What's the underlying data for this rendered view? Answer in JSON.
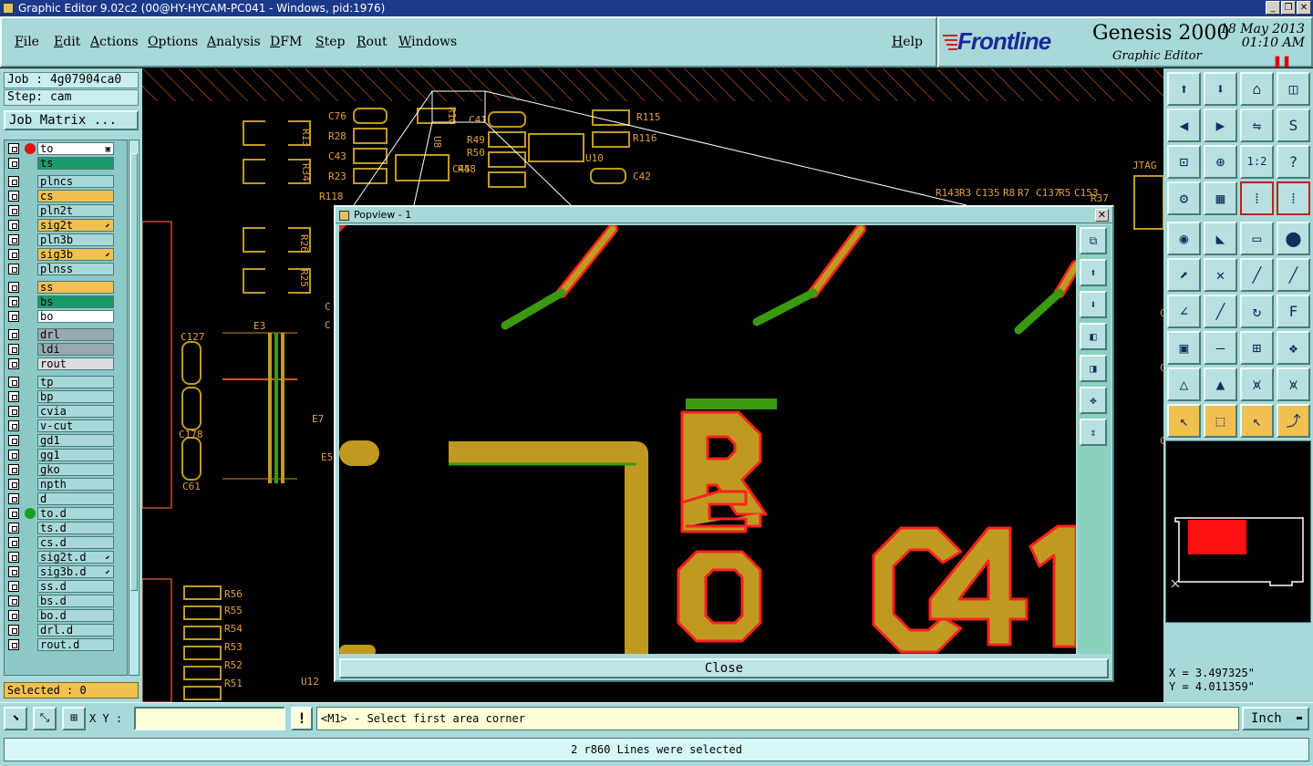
{
  "window": {
    "title": "Graphic Editor 9.02c2 (00@HY-HYCAM-PC041 - Windows, pid:1976)",
    "controls": [
      "_",
      "❐",
      "✕"
    ]
  },
  "menu": {
    "items": [
      "File",
      "Edit",
      "Actions",
      "Options",
      "Analysis",
      "DFM",
      "Step",
      "Rout",
      "Windows"
    ],
    "help": "Help"
  },
  "brand": {
    "logo": "Frontline",
    "product": "Genesis 2000",
    "subtitle": "Graphic Editor",
    "date": "18 May 2013",
    "time": "01:10 AM",
    "pause_glyph": "❚❚"
  },
  "left": {
    "job": "Job : 4g07904ca0",
    "step": "Step: cam",
    "job_matrix": "Job Matrix ...",
    "selected": "Selected : 0",
    "layers": [
      {
        "name": "to",
        "bg": "#ffffff",
        "dot": "#e01010",
        "mark": "▣",
        "active": true
      },
      {
        "name": "ts",
        "bg": "#1a9a6a",
        "dot": "",
        "mark": ""
      },
      {
        "name": "plncs",
        "bg": "#a8d8d8",
        "dot": "",
        "mark": ""
      },
      {
        "name": "cs",
        "bg": "#f0c050",
        "dot": "",
        "mark": ""
      },
      {
        "name": "pln2t",
        "bg": "#a8d8d8",
        "dot": "",
        "mark": ""
      },
      {
        "name": "sig2t",
        "bg": "#f0c050",
        "dot": "",
        "mark": "⬋"
      },
      {
        "name": "pln3b",
        "bg": "#a8d8d8",
        "dot": "",
        "mark": ""
      },
      {
        "name": "sig3b",
        "bg": "#f0c050",
        "dot": "",
        "mark": "⬋"
      },
      {
        "name": "plnss",
        "bg": "#a8d8d8",
        "dot": "",
        "mark": ""
      },
      {
        "name": "ss",
        "bg": "#f0c050",
        "dot": "",
        "mark": ""
      },
      {
        "name": "bs",
        "bg": "#1a9a6a",
        "dot": "",
        "mark": ""
      },
      {
        "name": "bo",
        "bg": "#ffffff",
        "dot": "",
        "mark": ""
      },
      {
        "name": "drl",
        "bg": "#9aa8b0",
        "dot": "",
        "mark": ""
      },
      {
        "name": "ldi",
        "bg": "#9aa8b0",
        "dot": "",
        "mark": ""
      },
      {
        "name": "rout",
        "bg": "#dcdcdc",
        "dot": "",
        "mark": ""
      },
      {
        "name": "tp",
        "bg": "#a8d8d8",
        "dot": "",
        "mark": ""
      },
      {
        "name": "bp",
        "bg": "#a8d8d8",
        "dot": "",
        "mark": ""
      },
      {
        "name": "cvia",
        "bg": "#a8d8d8",
        "dot": "",
        "mark": ""
      },
      {
        "name": "v-cut",
        "bg": "#a8d8d8",
        "dot": "",
        "mark": ""
      },
      {
        "name": "gd1",
        "bg": "#a8d8d8",
        "dot": "",
        "mark": ""
      },
      {
        "name": "gg1",
        "bg": "#a8d8d8",
        "dot": "",
        "mark": ""
      },
      {
        "name": "gko",
        "bg": "#a8d8d8",
        "dot": "",
        "mark": ""
      },
      {
        "name": "npth",
        "bg": "#a8d8d8",
        "dot": "",
        "mark": ""
      },
      {
        "name": "d",
        "bg": "#a8d8d8",
        "dot": "",
        "mark": ""
      },
      {
        "name": "to.d",
        "bg": "#a8d8d8",
        "dot": "#1aa020",
        "mark": ""
      },
      {
        "name": "ts.d",
        "bg": "#a8d8d8",
        "dot": "",
        "mark": ""
      },
      {
        "name": "cs.d",
        "bg": "#a8d8d8",
        "dot": "",
        "mark": ""
      },
      {
        "name": "sig2t.d",
        "bg": "#a8d8d8",
        "dot": "",
        "mark": "⬋"
      },
      {
        "name": "sig3b.d",
        "bg": "#a8d8d8",
        "dot": "",
        "mark": "⬋"
      },
      {
        "name": "ss.d",
        "bg": "#a8d8d8",
        "dot": "",
        "mark": ""
      },
      {
        "name": "bs.d",
        "bg": "#a8d8d8",
        "dot": "",
        "mark": ""
      },
      {
        "name": "bo.d",
        "bg": "#a8d8d8",
        "dot": "",
        "mark": ""
      },
      {
        "name": "drl.d",
        "bg": "#a8d8d8",
        "dot": "",
        "mark": ""
      },
      {
        "name": "rout.d",
        "bg": "#a8d8d8",
        "dot": "",
        "mark": ""
      }
    ]
  },
  "canvas": {
    "refdes": [
      "C76",
      "R28",
      "C43",
      "R23",
      "R118",
      "R13",
      "R34",
      "C41",
      "R49",
      "R50",
      "R48",
      "C45",
      "U8",
      "R10",
      "R115",
      "R116",
      "U10",
      "C42",
      "R143",
      "R3",
      "C135",
      "R8",
      "R7",
      "C137",
      "R5",
      "C153",
      "R37",
      "JTAG",
      "R26",
      "R25",
      "C127",
      "E3",
      "C178",
      "C61",
      "E7",
      "E5",
      "R56",
      "R55",
      "R54",
      "R53",
      "R52",
      "R51",
      "U12",
      "C",
      "C",
      "C",
      "C",
      "C"
    ]
  },
  "popview": {
    "title": "Popview - 1",
    "close_label": "Close",
    "side_icons": [
      "zoom-home-icon",
      "load-icon",
      "save-icon",
      "prev-icon",
      "next-icon",
      "zoom-fit-icon",
      "pan-icon"
    ],
    "side_glyphs": [
      "⧉",
      "⬆",
      "⬇",
      "◧",
      "◨",
      "✥",
      "⇕"
    ],
    "labels": [
      "R1",
      "0",
      "C41"
    ]
  },
  "tools": {
    "buttons": [
      {
        "name": "view-up-icon",
        "glyph": "⬆",
        "style": ""
      },
      {
        "name": "view-down-icon",
        "glyph": "⬇",
        "style": ""
      },
      {
        "name": "home-icon",
        "glyph": "⌂",
        "style": ""
      },
      {
        "name": "window-split-icon",
        "glyph": "◫",
        "style": ""
      },
      {
        "name": "view-left-icon",
        "glyph": "◀",
        "style": ""
      },
      {
        "name": "view-right-icon",
        "glyph": "▶",
        "style": ""
      },
      {
        "name": "mirror-icon",
        "glyph": "⇋",
        "style": ""
      },
      {
        "name": "s-curve-icon",
        "glyph": "S",
        "style": ""
      },
      {
        "name": "zoom-fit-icon",
        "glyph": "⊡",
        "style": ""
      },
      {
        "name": "zoom-center-icon",
        "glyph": "⊕",
        "style": ""
      },
      {
        "name": "scale-1-2-icon",
        "glyph": "1:2",
        "style": ""
      },
      {
        "name": "help-icon",
        "glyph": "?",
        "style": ""
      },
      {
        "name": "tools-icon",
        "glyph": "⚙",
        "style": ""
      },
      {
        "name": "grid-icon",
        "glyph": "▦",
        "style": ""
      },
      {
        "name": "snap-icon",
        "glyph": "⁞",
        "style": "red"
      },
      {
        "name": "snap-alt-icon",
        "glyph": "⁞",
        "style": "red"
      },
      {
        "name": "pad-add-icon",
        "glyph": "◉",
        "style": ""
      },
      {
        "name": "line-add-icon",
        "glyph": "◣",
        "style": ""
      },
      {
        "name": "measure-icon",
        "glyph": "▭",
        "style": ""
      },
      {
        "name": "fill-icon",
        "glyph": "⬤",
        "style": ""
      },
      {
        "name": "connect-icon",
        "glyph": "⬈",
        "style": ""
      },
      {
        "name": "cross-icon",
        "glyph": "✕",
        "style": ""
      },
      {
        "name": "move-line-icon",
        "glyph": "╱",
        "style": ""
      },
      {
        "name": "move-node-icon",
        "glyph": "╱",
        "style": ""
      },
      {
        "name": "angle-icon",
        "glyph": "∠",
        "style": ""
      },
      {
        "name": "slash-icon",
        "glyph": "╱",
        "style": ""
      },
      {
        "name": "arc-icon",
        "glyph": "↻",
        "style": ""
      },
      {
        "name": "feature-icon",
        "glyph": "F",
        "style": ""
      },
      {
        "name": "pads-icon",
        "glyph": "▣",
        "style": ""
      },
      {
        "name": "line-cut-icon",
        "glyph": "—",
        "style": ""
      },
      {
        "name": "box-icon",
        "glyph": "⊞",
        "style": ""
      },
      {
        "name": "shapes-icon",
        "glyph": "❖",
        "style": ""
      },
      {
        "name": "triangle-icon",
        "glyph": "△",
        "style": ""
      },
      {
        "name": "triangle-alt-icon",
        "glyph": "▲",
        "style": ""
      },
      {
        "name": "arch-icon",
        "glyph": "⩙",
        "style": ""
      },
      {
        "name": "arch-alt-icon",
        "glyph": "⩙",
        "style": ""
      },
      {
        "name": "select-pointer-icon",
        "glyph": "↖",
        "style": "yel"
      },
      {
        "name": "select-box-icon",
        "glyph": "⬚",
        "style": "yel"
      },
      {
        "name": "select-area-icon",
        "glyph": "↖",
        "style": "yel"
      },
      {
        "name": "select-net-icon",
        "glyph": "⤴",
        "style": "yel"
      }
    ],
    "coords": {
      "x": "X = 3.497325\"",
      "y": "Y = 4.011359\""
    }
  },
  "bottom": {
    "xy_label": "X Y :",
    "xy_value": "",
    "warn_glyph": "!",
    "prompt": "<M1> - Select first area corner",
    "unit": "Inch",
    "unit_glyph": "▬",
    "status": "2 r860 Lines were selected",
    "mode_glyphs": [
      "⬊",
      "⤡",
      "⊞"
    ]
  },
  "colors": {
    "panel": "#a8d8d8",
    "pad": "#c09a20",
    "trace_green": "#3a9a10",
    "highlight": "#ff2020",
    "text_orange": "#e0a040"
  }
}
